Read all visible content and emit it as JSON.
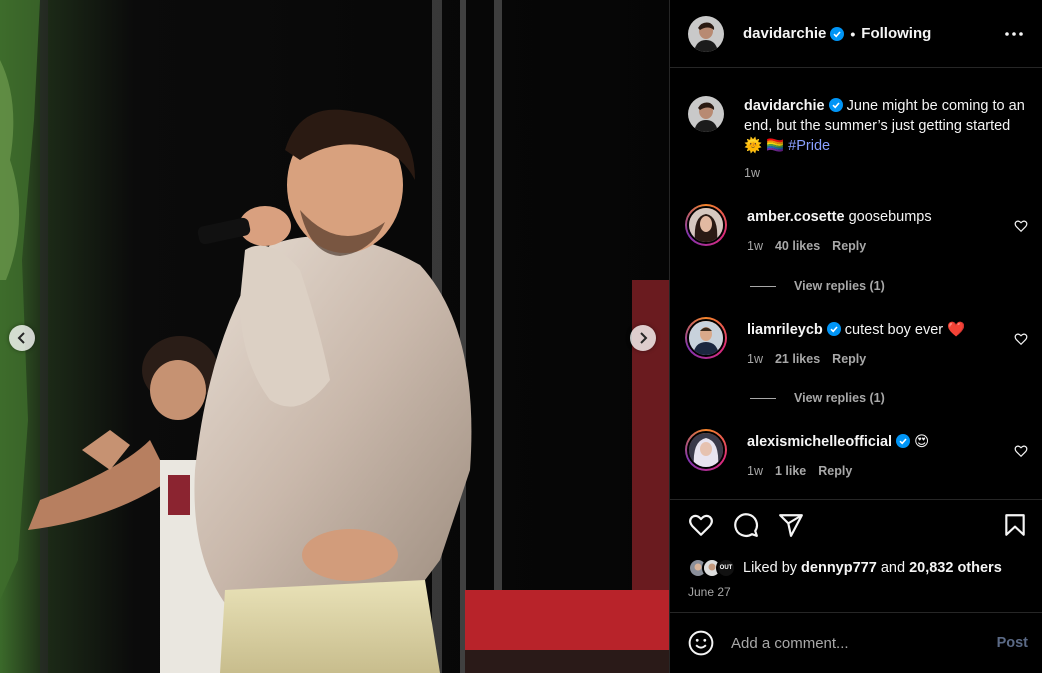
{
  "post": {
    "author": "davidarchie",
    "follow_status": "Following",
    "caption_user": "davidarchie",
    "caption_text": "June might be coming to an end, but the summer’s just getting started 🌞 🏳️‍🌈",
    "caption_hashtag": "#Pride",
    "caption_time": "1w",
    "liked_by_prefix": "Liked by",
    "liked_by_user": "dennyp777",
    "liked_by_and": "and",
    "liked_by_others": "20,832 others",
    "date": "June 27"
  },
  "comments": [
    {
      "user": "amber.cosette",
      "verified": false,
      "text": "goosebumps",
      "time": "1w",
      "likes": "40 likes",
      "reply": "Reply",
      "view_replies": "View replies (1)"
    },
    {
      "user": "liamrileycb",
      "verified": true,
      "text": "cutest boy ever ❤️",
      "time": "1w",
      "likes": "21 likes",
      "reply": "Reply",
      "view_replies": "View replies (1)"
    },
    {
      "user": "alexismichelleofficial",
      "verified": true,
      "text": "😍",
      "time": "1w",
      "likes": "1 like",
      "reply": "Reply"
    }
  ],
  "composer": {
    "placeholder": "Add a comment...",
    "post_label": "Post"
  },
  "liked_avatar_badge": "OUT",
  "colors": {
    "verified_blue": "#0095f6",
    "hashtag": "#8aa0ff",
    "post_button_disabled": "#5b6a86",
    "heart_emoji": "#e0245e"
  },
  "icons": [
    "chevron-left-icon",
    "chevron-right-icon",
    "more-icon",
    "verified-icon",
    "heart-icon",
    "comment-icon",
    "share-icon",
    "bookmark-icon",
    "emoji-icon"
  ]
}
